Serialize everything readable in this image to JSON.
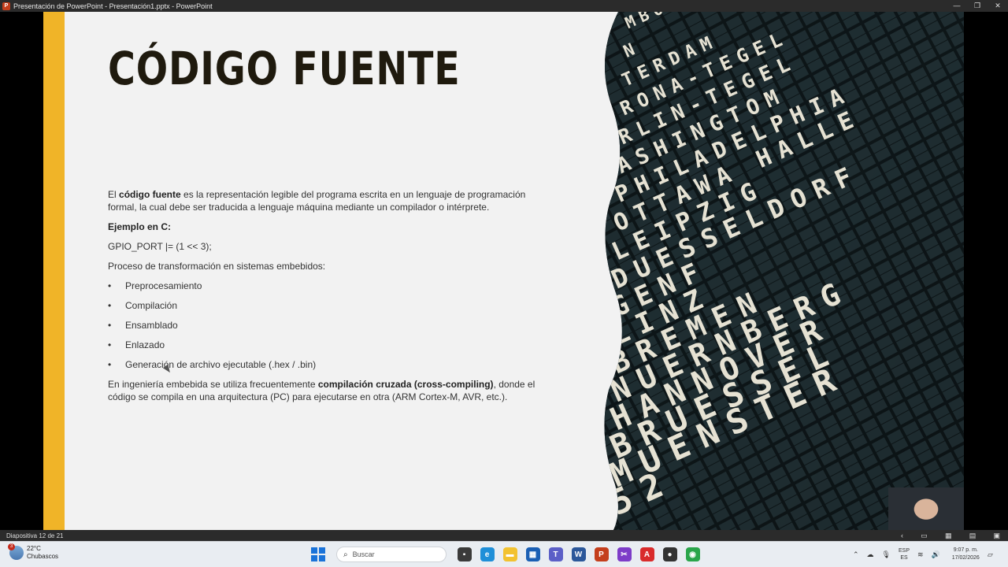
{
  "window": {
    "title": "Presentación de PowerPoint  -  Presentación1.pptx  -  PowerPoint",
    "controls": {
      "minimize": "—",
      "restore": "❐",
      "close": "✕"
    }
  },
  "slide": {
    "title": "CÓDIGO FUENTE",
    "intro_pre": "El ",
    "intro_bold": "código fuente",
    "intro_post": " es la representación legible del programa escrita en un lenguaje de programación formal, la cual debe ser traducida a lenguaje máquina mediante un compilador o intérprete.",
    "example_heading": "Ejemplo en C:",
    "example_code": "GPIO_PORT |= (1 << 3);",
    "process_heading": "Proceso de transformación en sistemas embebidos:",
    "bullets": [
      "Preprocesamiento",
      "Compilación",
      "Ensamblado",
      "Enlazado",
      "Generación de archivo ejecutable (.hex / .bin)"
    ],
    "closing_pre": "En ingeniería embebida se utiliza frecuentemente ",
    "closing_bold": "compilación cruzada (cross-compiling)",
    "closing_post": ", donde el código se compila en una arquitectura (PC) para ejecutarse en otra (ARM Cortex-M, AVR, etc.).",
    "board_words": [
      "MBO",
      "N",
      "TERDAM",
      "RONA-TEGEL",
      "RLIN-TEGEL",
      "ASHINGTOM",
      "PHILADELPHIA",
      "OTTAWA HALLE",
      "LEIPZIG",
      "DUESSELDORF",
      "GENF",
      "LINZ",
      "BREMEN",
      "NUERNBERG",
      "HANNOVER",
      "BRUESSEL",
      "MUENSTER",
      "52"
    ]
  },
  "statusbar": {
    "slide_counter": "Diapositiva 12 de 21"
  },
  "taskbar": {
    "weather_badge": "3",
    "weather_temp": "22°C",
    "weather_desc": "Chubascos",
    "search_placeholder": "Buscar",
    "lang_top": "ESP",
    "lang_bottom": "ES",
    "time": "9:07 p. m.",
    "date": "17/02/2026"
  }
}
